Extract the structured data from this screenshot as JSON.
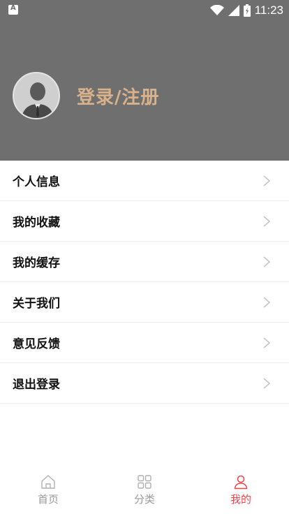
{
  "status_bar": {
    "time": "11:23",
    "icons": [
      "notification-a-icon",
      "wifi-icon",
      "signal-icon",
      "battery-icon"
    ]
  },
  "profile": {
    "login_label": "登录/注册",
    "avatar_icon": "user-avatar-icon"
  },
  "menu": {
    "items": [
      {
        "label": "个人信息"
      },
      {
        "label": "我的收藏"
      },
      {
        "label": "我的缓存"
      },
      {
        "label": "关于我们"
      },
      {
        "label": "意见反馈"
      },
      {
        "label": "退出登录"
      }
    ]
  },
  "tabbar": {
    "tabs": [
      {
        "label": "首页",
        "icon": "home-icon",
        "active": false
      },
      {
        "label": "分类",
        "icon": "grid-icon",
        "active": false
      },
      {
        "label": "我的",
        "icon": "user-icon",
        "active": true
      }
    ],
    "active_color": "#e8474f",
    "inactive_color": "#9a9a9a"
  },
  "colors": {
    "header_bg": "#6f6f6f",
    "login_text": "#d9b28a"
  }
}
